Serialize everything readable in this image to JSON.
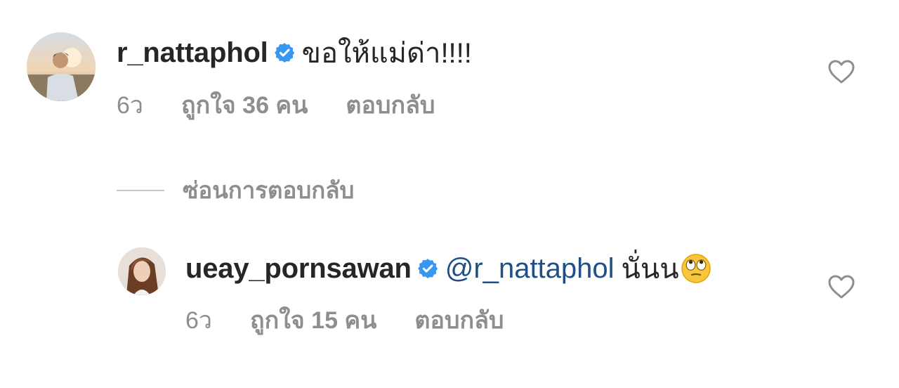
{
  "comments": [
    {
      "username": "r_nattaphol",
      "verified": true,
      "text": "ขอให้แม่ด่า!!!!",
      "time": "6ว",
      "likes": "ถูกใจ 36 คน",
      "reply_label": "ตอบกลับ",
      "avatar_icon": "avatar-photo"
    },
    {
      "username": "ueay_pornsawan",
      "verified": true,
      "mention": "@r_nattaphol",
      "text": "นั่นน",
      "emoji": "face-with-rolling-eyes",
      "time": "6ว",
      "likes": "ถูกใจ 15 คน",
      "reply_label": "ตอบกลับ",
      "avatar_icon": "avatar-photo"
    }
  ],
  "hide_replies_label": "ซ่อนการตอบกลับ",
  "colors": {
    "text": "#262626",
    "muted": "#8e8e8e",
    "mention": "#1f4f85",
    "verified": "#3897f0"
  }
}
